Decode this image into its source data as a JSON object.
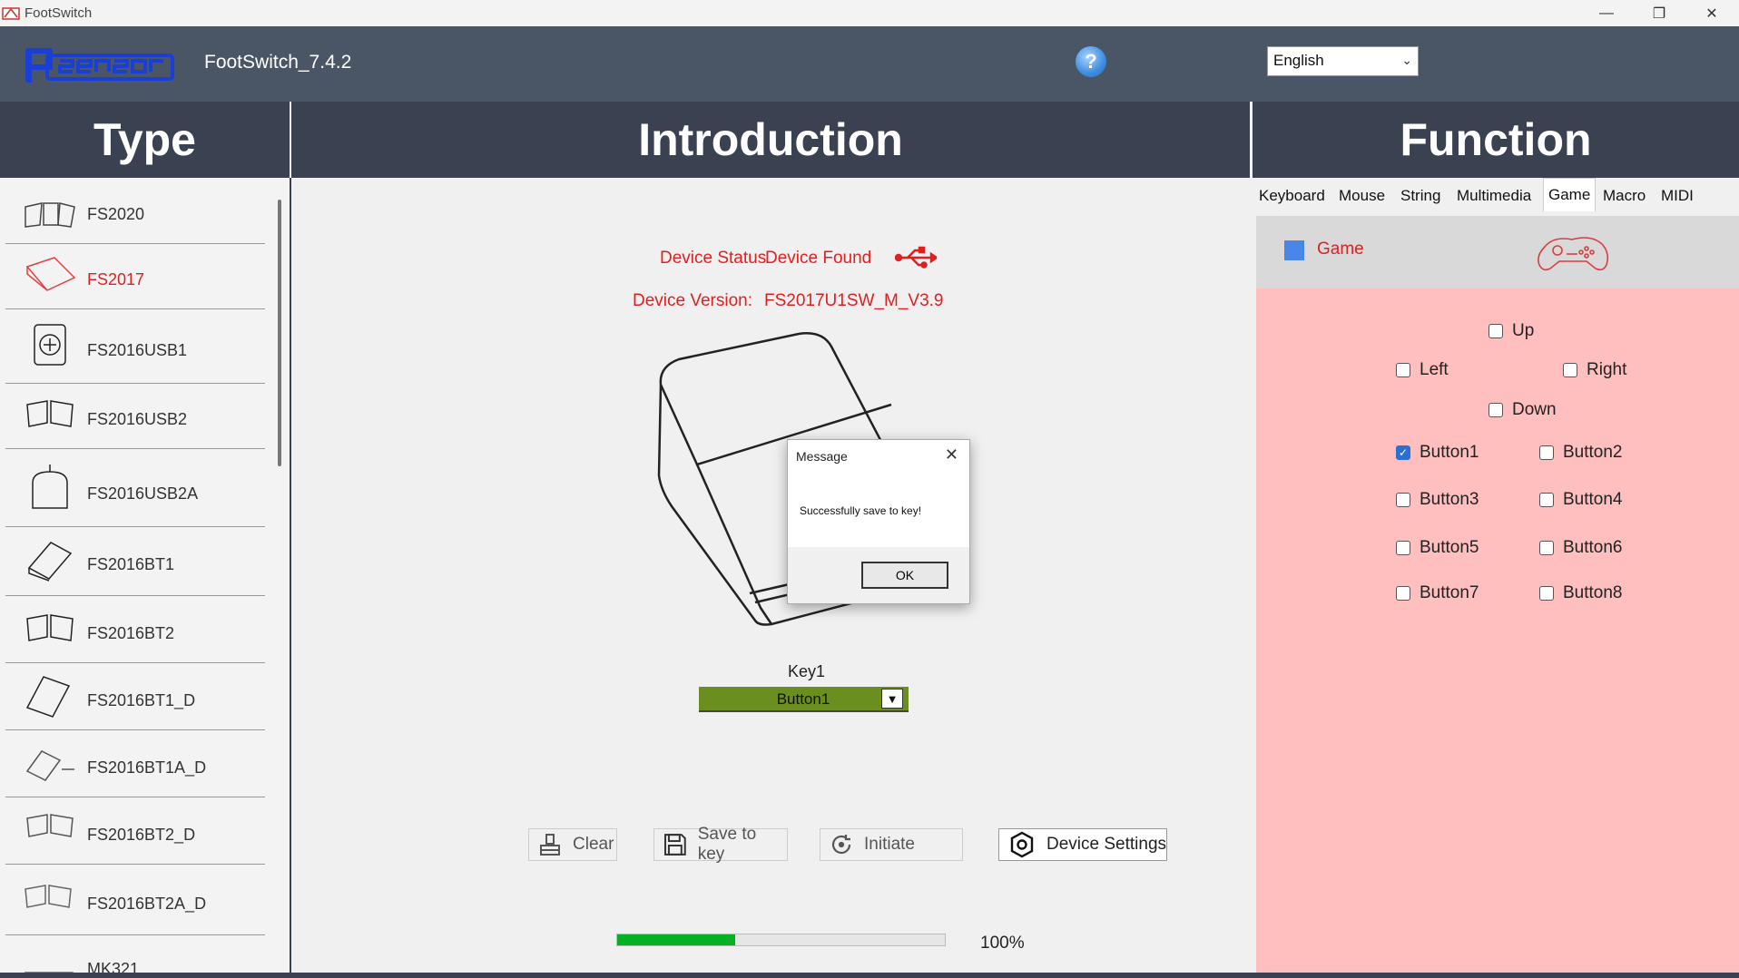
{
  "window": {
    "title": "FootSwitch"
  },
  "header": {
    "version": "FootSwitch_7.4.2",
    "help": "?",
    "language": "English"
  },
  "sections": {
    "type": "Type",
    "introduction": "Introduction",
    "function": "Function"
  },
  "types": [
    {
      "label": "FS2020",
      "icon": "fs2020-icon"
    },
    {
      "label": "FS2017",
      "icon": "fs2017-icon",
      "selected": true
    },
    {
      "label": "FS2016USB1",
      "icon": "fs2016usb1-icon"
    },
    {
      "label": "FS2016USB2",
      "icon": "fs2016usb2-icon"
    },
    {
      "label": "FS2016USB2A",
      "icon": "fs2016usb2a-icon"
    },
    {
      "label": "FS2016BT1",
      "icon": "fs2016bt1-icon"
    },
    {
      "label": "FS2016BT2",
      "icon": "fs2016bt2-icon"
    },
    {
      "label": "FS2016BT1_D",
      "icon": "fs2016bt1d-icon"
    },
    {
      "label": "FS2016BT1A_D",
      "icon": "fs2016bt1ad-icon"
    },
    {
      "label": "FS2016BT2_D",
      "icon": "fs2016bt2d-icon"
    },
    {
      "label": "FS2016BT2A_D",
      "icon": "fs2016bt2ad-icon"
    },
    {
      "label": "MK321",
      "icon": "mk321-icon"
    }
  ],
  "intro": {
    "status_label": "Device Status",
    "status_value": "Device Found",
    "version_label": "Device Version:",
    "version_value": "FS2017U1SW_M_V3.9",
    "key_label": "Key1",
    "key_value": "Button1",
    "buttons": {
      "clear": "Clear",
      "save": "Save to key",
      "initiate": "Initiate",
      "settings": "Device Settings"
    },
    "progress_percent": 36,
    "progress_text": "100%"
  },
  "dialog": {
    "title": "Message",
    "message": "Successfully save to key!",
    "ok": "OK"
  },
  "function": {
    "tabs": [
      "Keyboard",
      "Mouse",
      "String",
      "Multimedia",
      "Game",
      "Macro",
      "MIDI"
    ],
    "active_tab": "Game",
    "game_label": "Game",
    "checks": {
      "up": {
        "label": "Up",
        "checked": false
      },
      "left": {
        "label": "Left",
        "checked": false
      },
      "right": {
        "label": "Right",
        "checked": false
      },
      "down": {
        "label": "Down",
        "checked": false
      },
      "b1": {
        "label": "Button1",
        "checked": true
      },
      "b2": {
        "label": "Button2",
        "checked": false
      },
      "b3": {
        "label": "Button3",
        "checked": false
      },
      "b4": {
        "label": "Button4",
        "checked": false
      },
      "b5": {
        "label": "Button5",
        "checked": false
      },
      "b6": {
        "label": "Button6",
        "checked": false
      },
      "b7": {
        "label": "Button7",
        "checked": false
      },
      "b8": {
        "label": "Button8",
        "checked": false
      }
    }
  },
  "colors": {
    "header": "#4a5566",
    "section": "#3a4150",
    "accent_red": "#e02020",
    "key_green": "#6a8f1e",
    "pink": "#ffbfbf",
    "progress": "#06b025"
  }
}
